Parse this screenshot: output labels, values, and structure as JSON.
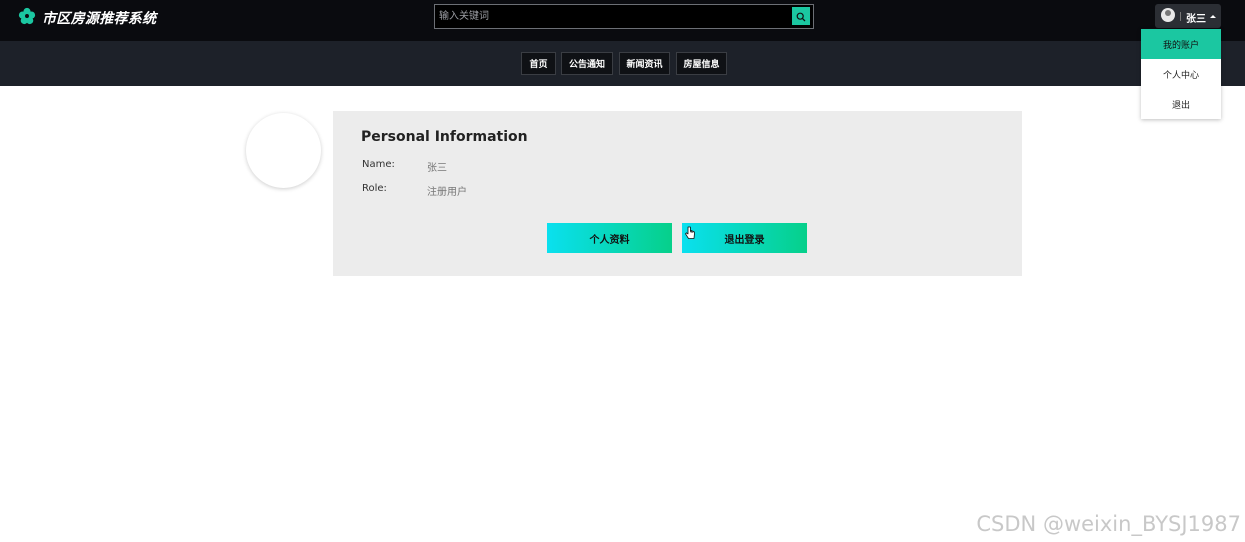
{
  "header": {
    "app_title": "市区房源推荐系统",
    "search": {
      "placeholder": "输入关键词",
      "value": ""
    },
    "user": {
      "name": "张三"
    }
  },
  "user_menu": {
    "items": [
      {
        "label": "我的账户",
        "active": true
      },
      {
        "label": "个人中心",
        "active": false
      },
      {
        "label": "退出",
        "active": false
      }
    ]
  },
  "nav": {
    "items": [
      {
        "label": "首页"
      },
      {
        "label": "公告通知"
      },
      {
        "label": "新闻资讯"
      },
      {
        "label": "房屋信息"
      }
    ]
  },
  "profile": {
    "title": "Personal Information",
    "name_label": "Name:",
    "name_value": "张三",
    "role_label": "Role:",
    "role_value": "注册用户",
    "buttons": {
      "profile_label": "个人资料",
      "logout_label": "退出登录"
    }
  },
  "watermark": "CSDN @weixin_BYSJ1987",
  "colors": {
    "accent": "#1bc7a1",
    "topbar": "#0a0b0f",
    "navbar": "#1d2129",
    "panel": "#ececec"
  }
}
